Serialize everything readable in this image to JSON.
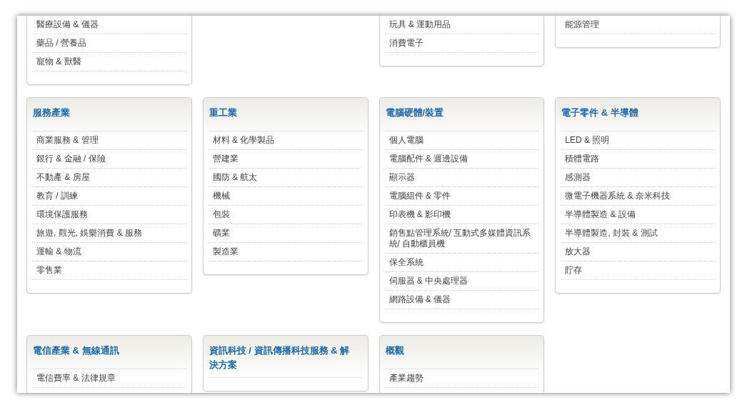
{
  "rows": [
    {
      "cards": [
        {
          "items": [
            "醫療設備 & 儀器",
            "藥品 / 營養品",
            "寵物 & 獸醫"
          ]
        },
        {
          "items": [
            "玩具 & 運動用品",
            "消費電子"
          ]
        },
        {
          "items": [
            "能源管理"
          ]
        }
      ]
    },
    {
      "cards": [
        {
          "title": "服務產業",
          "items": [
            "商業服務 & 管理",
            "銀行 & 金融 / 保險",
            "不動產 & 房屋",
            "教育 / 訓練",
            "環境保護服務",
            "旅遊, 觀光, 娛樂消費 & 服務",
            "運輸 & 物流",
            "零售業"
          ]
        },
        {
          "title": "重工業",
          "items": [
            "材料 & 化學製品",
            "營建業",
            "國防 & 航太",
            "機械",
            "包裝",
            "礦業",
            "製造業"
          ]
        },
        {
          "title": "電腦硬體/裝置",
          "items": [
            "個人電腦",
            "電腦配件 & 週邊設備",
            "顯示器",
            "電腦組件 & 零件",
            "印表機 & 影印機",
            "銷售點管理系統/ 互動式多媒體資訊系統/ 自動櫃員機",
            "保全系統",
            "伺服器 & 中央處理器",
            "網路設備 & 儀器"
          ]
        },
        {
          "title": "電子零件 & 半導體",
          "items": [
            "LED & 照明",
            "積體電路",
            "感測器",
            "微電子機器系統 & 奈米科技",
            "半導體製造 & 設備",
            "半導體製造, 封裝 & 測試",
            "放大器",
            "貯存"
          ]
        }
      ]
    },
    {
      "cards": [
        {
          "title": "電信產業 & 無線通訊",
          "items": [
            "電信費率 & 法律規章"
          ]
        },
        {
          "title": "資訊科技 / 資訊傳播科技服務 & 解決方案"
        },
        {
          "title": "概觀",
          "items": [
            "產業趨勢"
          ]
        }
      ]
    }
  ]
}
